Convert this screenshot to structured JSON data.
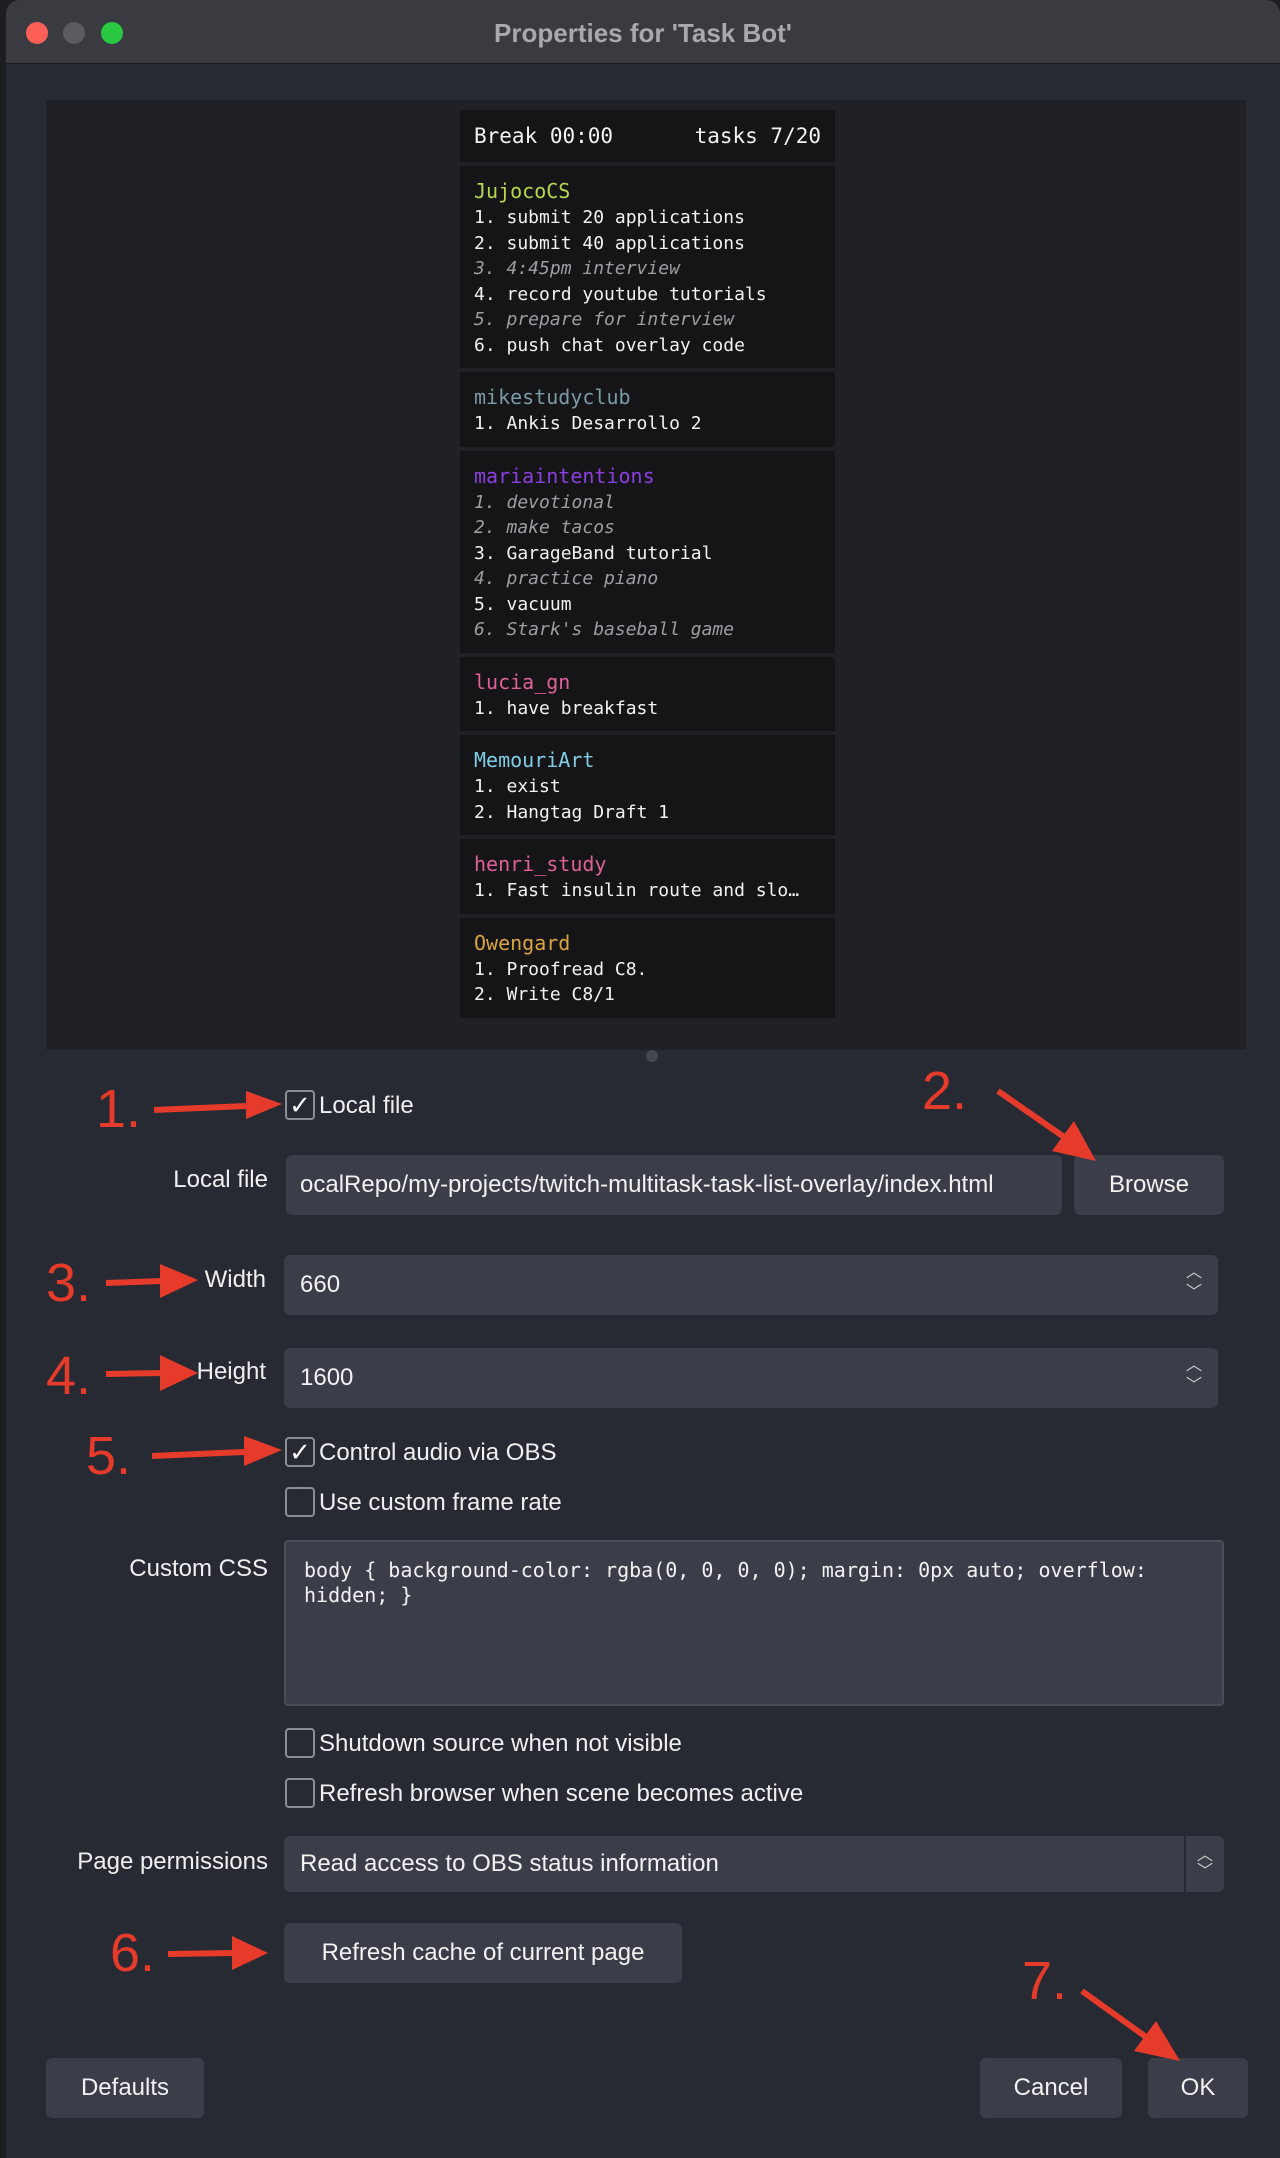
{
  "window": {
    "title": "Properties for 'Task Bot'"
  },
  "overlay": {
    "header_left": "Break 00:00",
    "header_right": "tasks 7/20",
    "cards": [
      {
        "user": "JujocoCS",
        "color": "#b5d94a",
        "tasks": [
          {
            "text": "1. submit 20 applications",
            "done": false
          },
          {
            "text": "2. submit 40 applications",
            "done": false
          },
          {
            "text": "3. 4:45pm interview",
            "done": true
          },
          {
            "text": "4. record youtube tutorials",
            "done": false
          },
          {
            "text": "5. prepare for interview",
            "done": true
          },
          {
            "text": "6. push chat overlay code",
            "done": false
          }
        ]
      },
      {
        "user": "mikestudyclub",
        "color": "#7a9aa6",
        "tasks": [
          {
            "text": "1. Ankis Desarrollo 2",
            "done": false
          }
        ]
      },
      {
        "user": "mariaintentions",
        "color": "#8a3ee0",
        "tasks": [
          {
            "text": "1. devotional",
            "done": true
          },
          {
            "text": "2. make tacos",
            "done": true
          },
          {
            "text": "3. GarageBand tutorial",
            "done": false
          },
          {
            "text": "4. practice piano",
            "done": true
          },
          {
            "text": "5. vacuum",
            "done": false
          },
          {
            "text": "6. Stark's baseball game",
            "done": true
          }
        ]
      },
      {
        "user": "lucia_gn",
        "color": "#e0609a",
        "tasks": [
          {
            "text": "1. have breakfast",
            "done": false
          }
        ]
      },
      {
        "user": "MemouriArt",
        "color": "#7ecfe6",
        "tasks": [
          {
            "text": "1. exist",
            "done": false
          },
          {
            "text": "2. Hangtag Draft 1",
            "done": false
          }
        ]
      },
      {
        "user": "henri_study",
        "color": "#e0609a",
        "tasks": [
          {
            "text": "1. Fast insulin route and slo…",
            "done": false
          }
        ]
      },
      {
        "user": "Owengard",
        "color": "#d9a441",
        "tasks": [
          {
            "text": "1. Proofread C8.",
            "done": false
          },
          {
            "text": "2. Write C8/1",
            "done": false
          }
        ]
      }
    ]
  },
  "form": {
    "local_file_checkbox": {
      "label": "Local file",
      "checked": true
    },
    "local_file": {
      "label": "Local file",
      "value": "ocalRepo/my-projects/twitch-multitask-task-list-overlay/index.html"
    },
    "browse_label": "Browse",
    "width": {
      "label": "Width",
      "value": "660"
    },
    "height": {
      "label": "Height",
      "value": "1600"
    },
    "control_audio": {
      "label": "Control audio via OBS",
      "checked": true
    },
    "custom_frame_rate": {
      "label": "Use custom frame rate",
      "checked": false
    },
    "custom_css": {
      "label": "Custom CSS",
      "value": "body { background-color: rgba(0, 0, 0, 0); margin: 0px auto; overflow:\nhidden; }"
    },
    "shutdown_source": {
      "label": "Shutdown source when not visible",
      "checked": false
    },
    "refresh_browser": {
      "label": "Refresh browser when scene becomes active",
      "checked": false
    },
    "page_permissions": {
      "label": "Page permissions",
      "value": "Read access to OBS status information"
    },
    "refresh_cache_label": "Refresh cache of current page",
    "defaults_label": "Defaults",
    "cancel_label": "Cancel",
    "ok_label": "OK"
  },
  "annotations": [
    "1.",
    "2.",
    "3.",
    "4.",
    "5.",
    "6.",
    "7."
  ],
  "colors": {
    "annotation": "#e63b2a",
    "window_bg": "#272a33",
    "control_bg": "#3b3e48"
  }
}
